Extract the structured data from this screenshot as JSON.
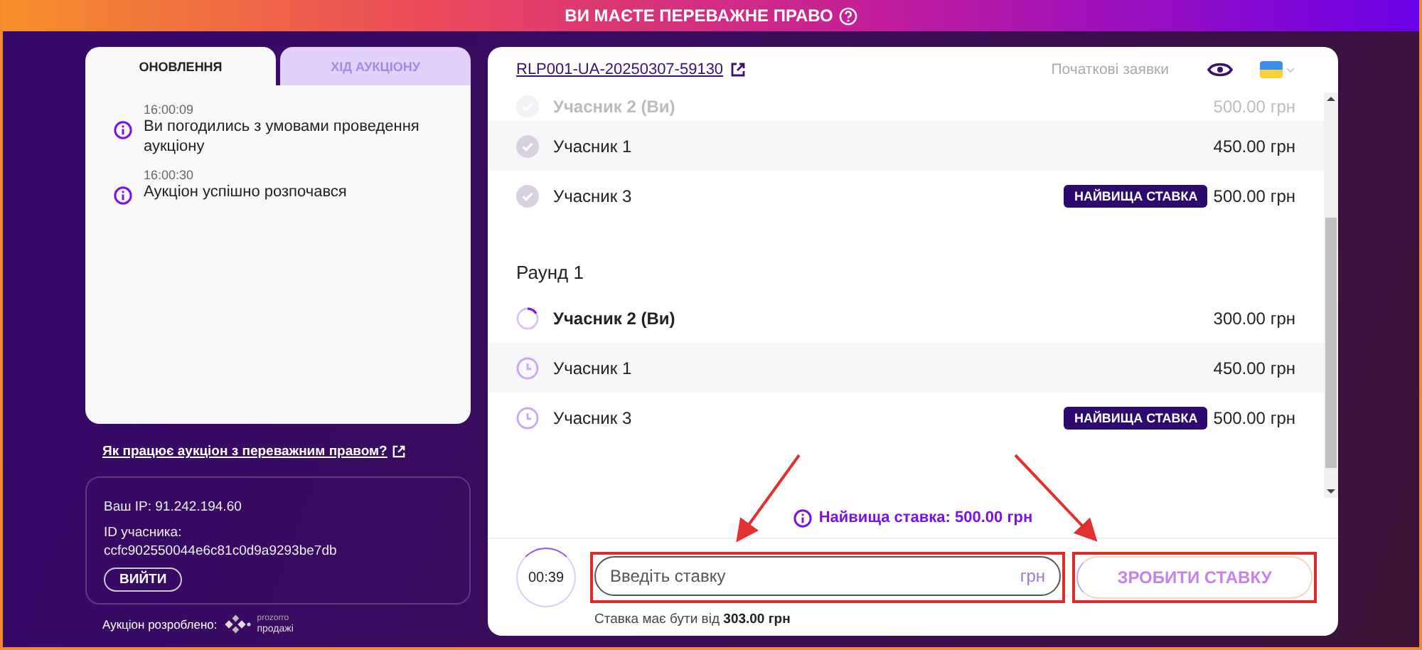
{
  "banner": {
    "title": "ВИ МАЄТЕ ПЕРЕВАЖНЕ ПРАВО"
  },
  "left_panel": {
    "tabs": [
      {
        "label": "ОНОВЛЕННЯ",
        "selected": true
      },
      {
        "label": "ХІД АУКЦІОНУ",
        "selected": false
      }
    ],
    "updates": [
      {
        "time": "16:00:09",
        "text": "Ви погодились з умовами проведення аукціону"
      },
      {
        "time": "16:00:30",
        "text": "Аукціон успішно розпочався"
      }
    ],
    "help_link": "Як працює аукціон з переважним правом?",
    "session": {
      "ip": "Ваш IP: 91.242.194.60",
      "id_label": "ID учасника:",
      "id": "ccfc902550044e6c81c0d9a9293be7db",
      "logout_button": "ВИЙТИ"
    },
    "footer": {
      "text": "Аукціон розроблено:",
      "logo_top": "prozorro",
      "logo_bottom": "продажі"
    }
  },
  "auction": {
    "lot_link": "RLP001-UA-20250307-59130",
    "initial_bids_link": "Початкові заявки",
    "rounds": [
      {
        "bids": [
          {
            "name": "Учасник 2 (Ви)",
            "amount": "500.00 грн",
            "kind": "done",
            "you": true,
            "faded": true
          },
          {
            "name": "Учасник 1",
            "amount": "450.00 грн",
            "kind": "done",
            "you": false,
            "faded": false
          },
          {
            "name": "Учасник 3",
            "amount": "500.00 грн",
            "kind": "done",
            "you": false,
            "faded": false,
            "badge": "НАЙВИЩА СТАВКА"
          }
        ]
      },
      {
        "title": "Раунд 1",
        "bids": [
          {
            "name": "Учасник 2 (Ви)",
            "amount": "300.00 грн",
            "kind": "active",
            "you": true,
            "faded": false
          },
          {
            "name": "Учасник 1",
            "amount": "450.00 грн",
            "kind": "pending",
            "you": false,
            "faded": false
          },
          {
            "name": "Учасник 3",
            "amount": "500.00 грн",
            "kind": "pending",
            "you": false,
            "faded": false,
            "badge": "НАЙВИЩА СТАВКА"
          }
        ]
      }
    ],
    "highest_bid": "Найвища ставка: 500.00 грн",
    "timer": "00:39",
    "bid_input": {
      "placeholder": "Введіть ставку",
      "unit": "грн"
    },
    "submit_button": {
      "label": "ЗРОБИТИ СТАВКУ",
      "disabled": true
    },
    "hint": "Ставка має бути від **303.00 грн**"
  }
}
